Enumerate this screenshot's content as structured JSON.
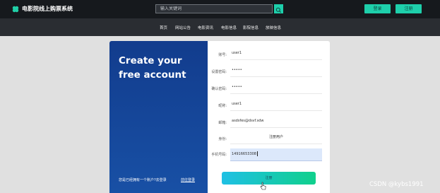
{
  "header": {
    "logo_icon": "clover-logo-icon",
    "site_title": "电影院线上购票系统",
    "search_placeholder": "输入关键词",
    "search_icon": "search-icon",
    "login_label": "登录",
    "register_label": "注册"
  },
  "nav": {
    "items": [
      "首页",
      "网站公告",
      "电影资讯",
      "电影信息",
      "影院信息",
      "放映信息"
    ]
  },
  "card": {
    "title": "Create your free account",
    "login_hint": "您是已经拥有一个账户?去登录",
    "login_link": "前往登录"
  },
  "form": {
    "fields": [
      {
        "label": "账号:",
        "value": "user1"
      },
      {
        "label": "设置密码:",
        "value": "•••••"
      },
      {
        "label": "确认密码:",
        "value": "•••••"
      },
      {
        "label": "昵称:",
        "value": "user1"
      },
      {
        "label": "邮箱:",
        "value": "asdsfes@dsvf.sdw"
      },
      {
        "label": "身份:",
        "value": "注册用户"
      },
      {
        "label": "手机号码:",
        "value": "14916653308"
      }
    ],
    "submit_label": "注册"
  },
  "watermark": "CSDN @kybs1991",
  "colors": {
    "accent": "#1ecfab",
    "topbar": "#16191d",
    "navbar": "#2a2d32",
    "panel_blue": "#123c8d",
    "active_field": "#dce8fb"
  }
}
